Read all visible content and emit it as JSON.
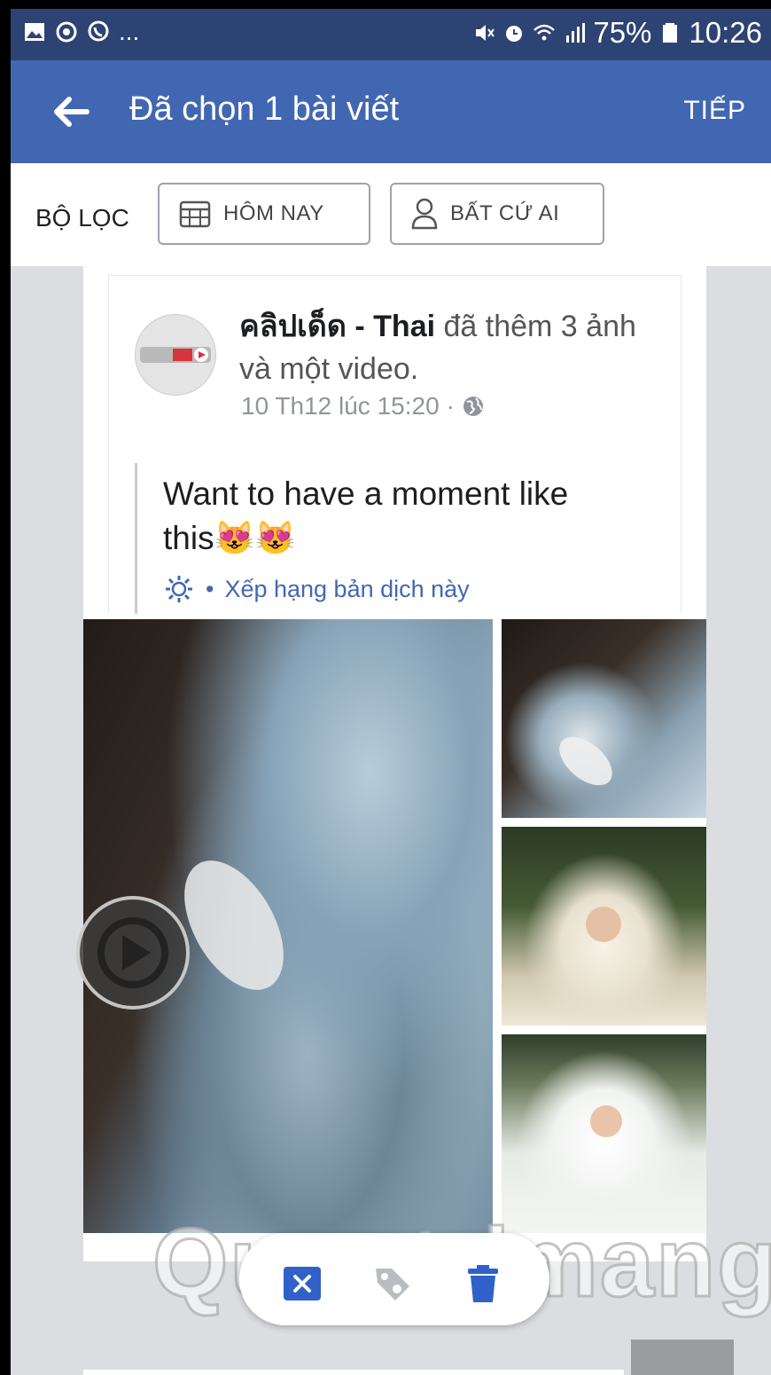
{
  "status_bar": {
    "left_icons": [
      "image-icon",
      "circle-icon",
      "viber-icon"
    ],
    "more": "...",
    "right_icons": [
      "mute-icon",
      "alarm-icon",
      "wifi-icon",
      "signal-icon"
    ],
    "battery": "75%",
    "time": "10:26"
  },
  "app_bar": {
    "title": "Đã chọn 1 bài viết",
    "next_label": "TIẾP"
  },
  "filter_bar": {
    "label": "BỘ LỌC",
    "date_chip": "HÔM NAY",
    "audience_chip": "BẤT CỨ AI"
  },
  "post": {
    "author": "คลิปเด็ด - Thai",
    "action_text": " đã thêm 3 ảnh và một video.",
    "time": "10 Th12 lúc 15:20",
    "separator": "·",
    "text": "Want to have a moment like this😻😻",
    "rate_dot": "•",
    "rate_translation": "Xếp hạng bản dịch này"
  },
  "watermark": "Quantrimang",
  "colors": {
    "status_bar": "#2d4373",
    "app_bar": "#4267b2",
    "link": "#4267b2",
    "action_x": "#2f61c9"
  }
}
